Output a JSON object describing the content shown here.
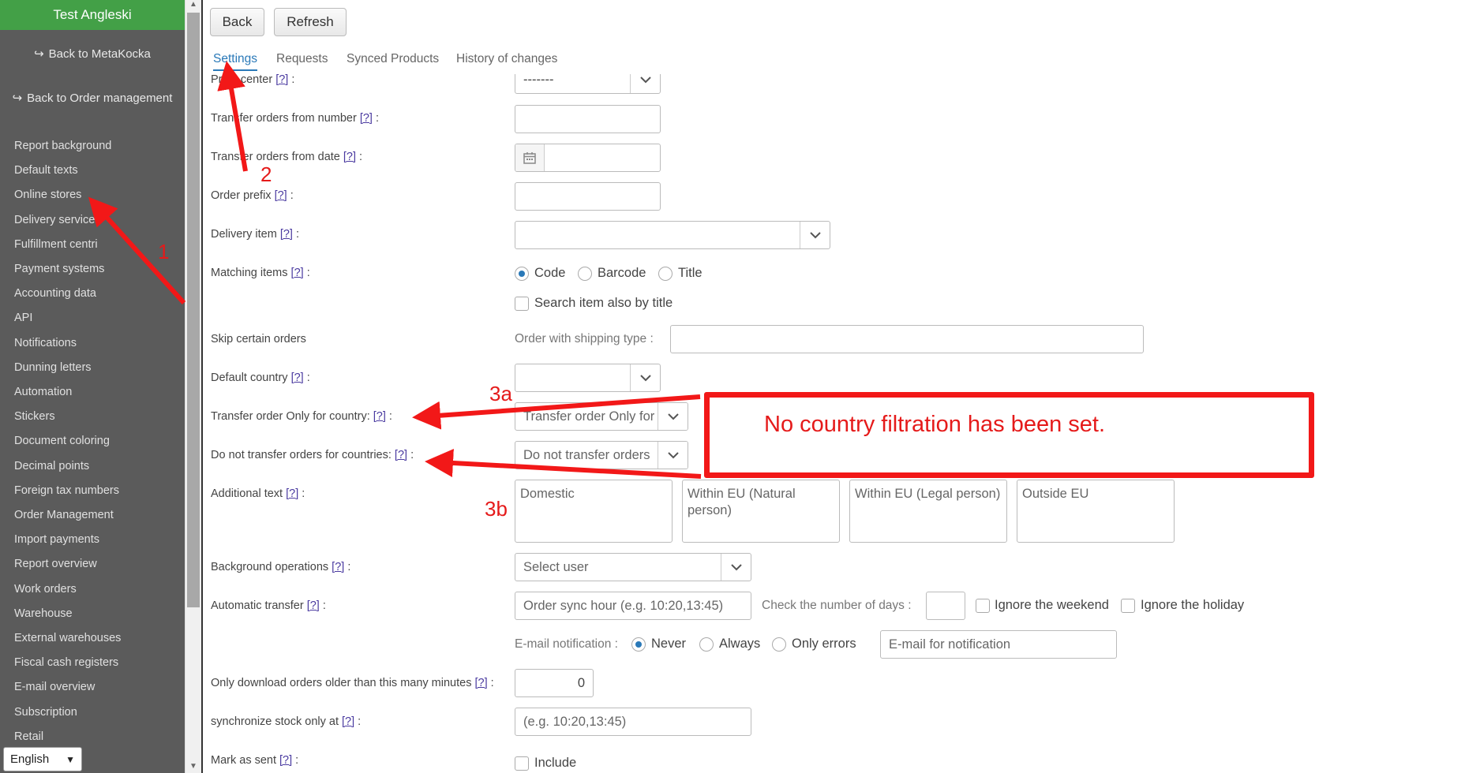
{
  "sidebar": {
    "title": "Test Angleski",
    "back_metakocka": "Back to MetaKocka",
    "back_orders": "Back to Order management",
    "items": [
      "Report background",
      "Default texts",
      "Online stores",
      "Delivery services",
      "Fulfillment centri",
      "Payment systems",
      "Accounting data",
      "API",
      "Notifications",
      "Dunning letters",
      "Automation",
      "Stickers",
      "Document coloring",
      "Decimal points",
      "Foreign tax numbers",
      "Order Management",
      "Import payments",
      "Report overview",
      "Work orders",
      "Warehouse",
      "External warehouses",
      "Fiscal cash registers",
      "E-mail overview",
      "Subscription",
      "Retail"
    ],
    "language": "English"
  },
  "toolbar": {
    "back": "Back",
    "refresh": "Refresh"
  },
  "tabs": [
    "Settings",
    "Requests",
    "Synced Products",
    "History of changes"
  ],
  "form": {
    "help": "[?]",
    "profit_center": {
      "label": "Profit center",
      "value": "-------"
    },
    "transfer_number": {
      "label": "Transfer orders from number"
    },
    "transfer_date": {
      "label": "Transfer orders from date"
    },
    "order_prefix": {
      "label": "Order prefix"
    },
    "delivery_item": {
      "label": "Delivery item"
    },
    "matching": {
      "label": "Matching items",
      "options": [
        "Code",
        "Barcode",
        "Title"
      ],
      "selected": "Code",
      "search_by_title": "Search item also by title"
    },
    "skip": {
      "label": "Skip certain orders",
      "shipping_label": "Order with shipping type :"
    },
    "default_country": {
      "label": "Default country"
    },
    "only_country": {
      "label": "Transfer order Only for country:",
      "placeholder": "Transfer order Only for"
    },
    "not_countries": {
      "label": "Do not transfer orders for countries:",
      "placeholder": "Do not transfer orders"
    },
    "additional_text": {
      "label": "Additional text",
      "boxes": [
        "Domestic",
        "Within EU (Natural person)",
        "Within EU (Legal person)",
        "Outside EU"
      ]
    },
    "background": {
      "label": "Background operations",
      "value": "Select user"
    },
    "auto_transfer": {
      "label": "Automatic transfer",
      "sync_placeholder": "Order sync hour (e.g. 10:20,13:45)",
      "days_label": "Check the number of days :",
      "weekend": "Ignore the weekend",
      "holiday": "Ignore the holiday",
      "email_label": "E-mail notification :",
      "email_options": [
        "Never",
        "Always",
        "Only errors"
      ],
      "email_selected": "Never",
      "email_placeholder": "E-mail for notification"
    },
    "older_minutes": {
      "label": "Only download orders older than this many minutes",
      "value": "0"
    },
    "sync_stock": {
      "label": "synchronize stock only at",
      "placeholder": "(e.g. 10:20,13:45)"
    },
    "mark_sent": {
      "label": "Mark as sent",
      "include": "Include"
    }
  },
  "annotations": {
    "callout": "No country filtration has been set.",
    "n1": "1",
    "n2": "2",
    "n3a": "3a",
    "n3b": "3b",
    "color": "#e51a1a"
  }
}
